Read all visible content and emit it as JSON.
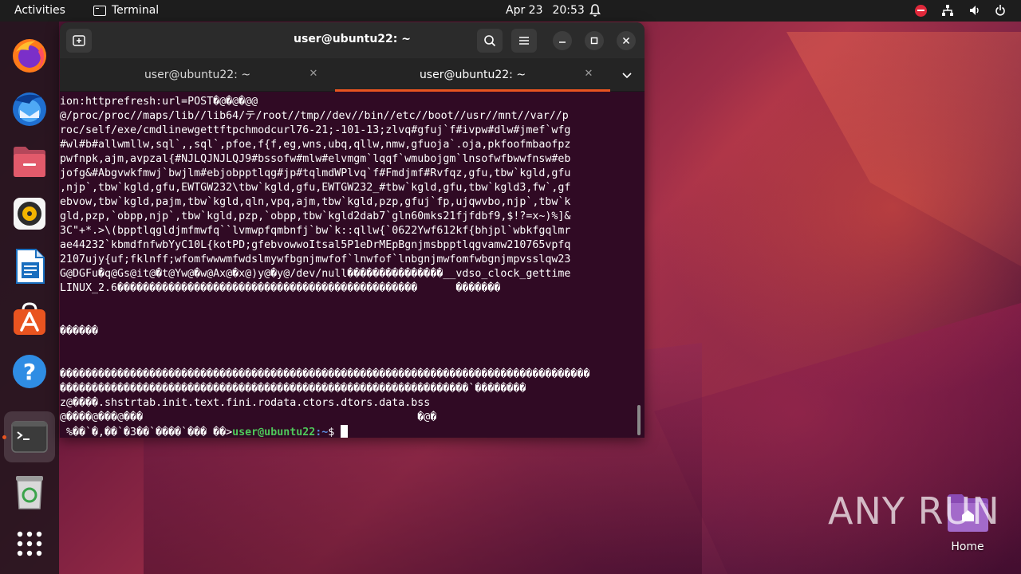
{
  "topbar": {
    "activities": "Activities",
    "app_name": "Terminal",
    "date": "Apr 23",
    "time": "20:53"
  },
  "dock": {
    "items": [
      {
        "name": "firefox-icon"
      },
      {
        "name": "thunderbird-icon"
      },
      {
        "name": "files-icon"
      },
      {
        "name": "rhythmbox-icon"
      },
      {
        "name": "libreoffice-writer-icon"
      },
      {
        "name": "app-center-icon"
      },
      {
        "name": "help-icon"
      },
      {
        "name": "terminal-icon"
      },
      {
        "name": "trash-icon"
      },
      {
        "name": "show-apps-icon"
      }
    ]
  },
  "window": {
    "title": "user@ubuntu22: ~",
    "tabs": [
      {
        "label": "user@ubuntu22: ~",
        "active": false
      },
      {
        "label": "user@ubuntu22: ~",
        "active": true
      }
    ]
  },
  "terminal": {
    "lines": [
      "ion:httprefresh:url=POST�@�@�@@",
      "@/proc/proc//maps/lib//lib64/テ/root//tmp//dev//bin//etc//boot//usr//mnt//var//p",
      "roc/self/exe/cmdlinewgettftpchmodcurl76-21;-101-13;zlvq#gfuj`f#ivpw#dlw#jmef`wfg",
      "#wl#b#allwmllw,sql`,,sql`,pfoe,f{f,eg,wns,ubq,qllw,nmw,gfuoja`.oja,pkfoofmbaofpz",
      "pwfnpk,ajm,avpzal{#NJLQJNJLQJ9#bssofw#mlw#elvmgm`lqqf`wmubojgm`lnsofwfbwwfnsw#eb",
      "jofg&#Abgvwkfmwj`bwjlm#ebjobpptlqg#jp#tqlmdWPlvq`f#Fmdjmf#Rvfqz,gfu,tbw`kgld,gfu",
      ",njp`,tbw`kgld,gfu,EWTGW232\\tbw`kgld,gfu,EWTGW232_#tbw`kgld,gfu,tbw`kgld3,fw`,gf",
      "ebvow,tbw`kgld,pajm,tbw`kgld,qln,vpq,ajm,tbw`kgld,pzp,gfuj`fp,ujqwvbo,njp`,tbw`k",
      "gld,pzp,`obpp,njp`,tbw`kgld,pzp,`obpp,tbw`kgld2dab7`gln60mks21fjfdbf9,$!?=x~)%]&",
      "3C\"+*.>\\(bpptlqgldjmfmwfq``lvmwpfqmbnfj`bw`k::qllw{`0622Ywf612kf{bhjpl`wbkfgqlmr",
      "ae44232`kbmdfnfwbYyC10L{kotPD;gfebvowwoItsal5P1eDrMEpBgnjmsbpptlqgvamw210765vpfq",
      "2107ujy{uf;fklnff;wfomfwwwmfwdslmywfbgnjmwfof`lnwfof`lnbgnjmwfomfwbgnjmpvsslqw23",
      "G@DGFu�q@Gs@it@�t@Yw@�w@Ax@�x@)y@�y@/dev/null���������������__vdso_clock_gettime",
      "LINUX_2.6�����������������������������������������������      �������",
      "",
      "",
      "������",
      "",
      "",
      "�����������������������������������������������������������������������������������",
      "����������������������������������������������������������������`��������",
      "z@����.shstrtab.init.text.fini.rodata.ctors.dtors.data.bss",
      "@����@���@���                                           �@�"
    ],
    "prompt_prefix": " %��`�,��`�3��`����`��� ��>",
    "prompt_user": "user@ubuntu22",
    "prompt_path": ":~",
    "prompt_symbol": "$ "
  },
  "desktop": {
    "home_label": "Home",
    "watermark": "ANY RUN"
  },
  "colors": {
    "terminal_bg": "#300a24",
    "accent": "#e95420",
    "prompt_user": "#4fc85a",
    "prompt_path": "#5b8de0"
  }
}
